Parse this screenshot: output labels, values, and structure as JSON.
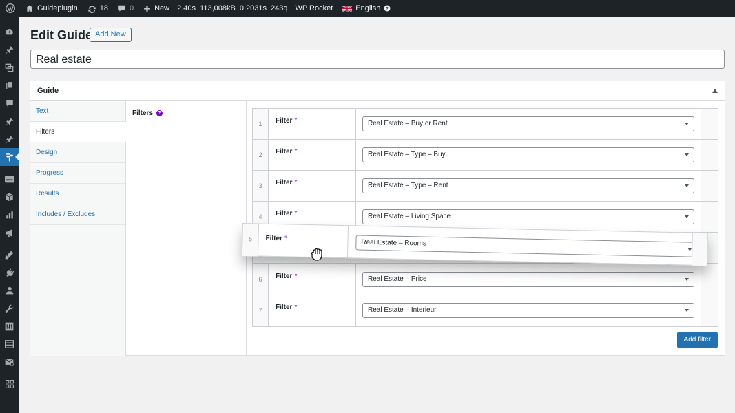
{
  "adminbar": {
    "site_name": "Guideplugin",
    "updates_count": "18",
    "comments_count": "0",
    "new_label": "New",
    "qm_time": "2.40s",
    "qm_memory": "113,008kB",
    "qm_db_time": "0.2031s",
    "qm_queries": "243q",
    "rocket_label": "WP Rocket",
    "language_label": "English"
  },
  "page": {
    "title": "Edit Guide",
    "add_new_label": "Add New",
    "post_title_value": "Real estate"
  },
  "metabox": {
    "title": "Guide",
    "tabs": [
      "Text",
      "Filters",
      "Design",
      "Progress",
      "Results",
      "Includes / Excludes"
    ],
    "active_tab": "Filters",
    "field_label": "Filters",
    "help_glyph": "?",
    "rows": [
      {
        "num": "1",
        "label": "Filter",
        "req": "*",
        "value": "Real Estate – Buy or Rent"
      },
      {
        "num": "2",
        "label": "Filter",
        "req": "*",
        "value": "Real Estate – Type – Buy"
      },
      {
        "num": "3",
        "label": "Filter",
        "req": "*",
        "value": "Real Estate – Type – Rent"
      },
      {
        "num": "4",
        "label": "Filter",
        "req": "*",
        "value": "Real Estate – Living Space"
      },
      {
        "num": "5",
        "label": "Filter",
        "req": "*",
        "value": "Real Estate – Rooms"
      },
      {
        "num": "6",
        "label": "Filter",
        "req": "*",
        "value": "Real Estate – Price"
      },
      {
        "num": "7",
        "label": "Filter",
        "req": "*",
        "value": "Real Estate – Interieur"
      }
    ],
    "add_filter_label": "Add filter"
  },
  "colors": {
    "accent": "#2271b1",
    "required": "#7a00df",
    "adminbar": "#1d2327"
  },
  "icons": {
    "menu": [
      "dashboard-icon",
      "pin-icon",
      "media-icon",
      "pages-icon",
      "comments-icon",
      "pin-icon",
      "pin-icon",
      "guide-icon",
      "woocommerce-icon",
      "products-icon",
      "analytics-icon",
      "marketing-icon",
      "appearance-icon",
      "plugins-icon",
      "users-icon",
      "tools-icon",
      "settings-icon",
      "table-icon",
      "mail-icon",
      "grid-icon"
    ]
  }
}
